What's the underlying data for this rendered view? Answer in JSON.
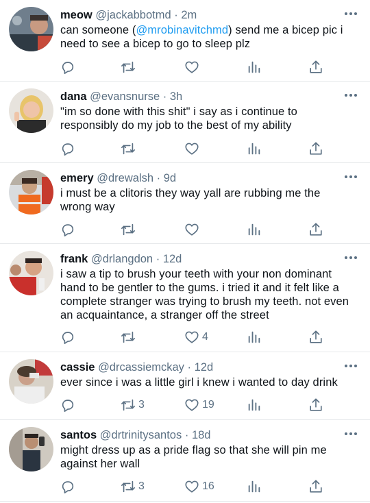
{
  "tweets": [
    {
      "name": "meow",
      "handle": "@jackabbotmd",
      "separator": "·",
      "time": "2m",
      "lines": [
        {
          "pre": "can someone (",
          "mention": "@mrobinavitchmd",
          "post": ") send me a bicep pic i"
        },
        {
          "pre": "need to see a bicep to go to sleep plz",
          "mention": "",
          "post": ""
        }
      ],
      "retweets": "",
      "likes": ""
    },
    {
      "name": "dana",
      "handle": "@evansnurse",
      "separator": "·",
      "time": "3h",
      "lines": [
        {
          "pre": "\"im so done with this shit\" i say as i continue to",
          "mention": "",
          "post": ""
        },
        {
          "pre": "responsibly do my job to the best of my ability",
          "mention": "",
          "post": ""
        }
      ],
      "retweets": "",
      "likes": ""
    },
    {
      "name": "emery",
      "handle": "@drewalsh",
      "separator": "·",
      "time": "9d",
      "lines": [
        {
          "pre": "i must be a clitoris they way yall are rubbing me the",
          "mention": "",
          "post": ""
        },
        {
          "pre": "wrong way",
          "mention": "",
          "post": ""
        }
      ],
      "retweets": "",
      "likes": ""
    },
    {
      "name": "frank",
      "handle": "@drlangdon",
      "separator": "·",
      "time": "12d",
      "lines": [
        {
          "pre": "i saw a tip to brush your teeth with your non dominant",
          "mention": "",
          "post": ""
        },
        {
          "pre": "hand to be gentler to the gums. i tried it and it felt like a",
          "mention": "",
          "post": ""
        },
        {
          "pre": "complete stranger was trying to brush my teeth. not even",
          "mention": "",
          "post": ""
        },
        {
          "pre": "an acquaintance, a stranger off the street",
          "mention": "",
          "post": ""
        }
      ],
      "retweets": "",
      "likes": "4"
    },
    {
      "name": "cassie",
      "handle": "@drcassiemckay",
      "separator": "·",
      "time": "12d",
      "lines": [
        {
          "pre": "ever since i was a little girl i knew i wanted to day drink",
          "mention": "",
          "post": ""
        }
      ],
      "retweets": "3",
      "likes": "19"
    },
    {
      "name": "santos",
      "handle": "@drtrinitysantos",
      "separator": "·",
      "time": "18d",
      "lines": [
        {
          "pre": "might dress up as a pride flag so that she will pin me",
          "mention": "",
          "post": ""
        },
        {
          "pre": "against her wall",
          "mention": "",
          "post": ""
        }
      ],
      "retweets": "3",
      "likes": "16"
    }
  ],
  "icons": {
    "reply": "reply-icon",
    "retweet": "retweet-icon",
    "like": "heart-icon",
    "stats": "analytics-icon",
    "share": "share-icon",
    "more": "more-icon"
  },
  "colors": {
    "text": "#0f1419",
    "secondary": "#5b7083",
    "mention": "#1d9bf0",
    "divider": "#e6e9eb"
  }
}
